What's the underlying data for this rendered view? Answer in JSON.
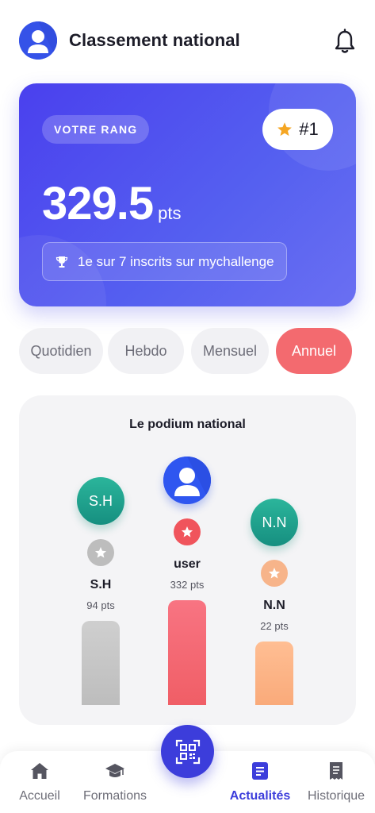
{
  "header": {
    "title": "Classement national",
    "avatar_icon": "user-avatar-icon",
    "notification_icon": "bell-icon"
  },
  "rank_card": {
    "label": "VOTRE RANG",
    "rank": "#1",
    "rank_icon": "star-icon",
    "score": "329.5",
    "score_unit": "pts",
    "info_text": "1e sur 7 inscrits sur mychallenge",
    "info_icon": "trophy-icon",
    "colors": {
      "gradient_start": "#4a40ee",
      "gradient_end": "#6a6ff2",
      "star": "#f5a623"
    }
  },
  "period_tabs": [
    {
      "label": "Quotidien",
      "active": false
    },
    {
      "label": "Hebdo",
      "active": false
    },
    {
      "label": "Mensuel",
      "active": false
    },
    {
      "label": "Annuel",
      "active": true
    }
  ],
  "podium": {
    "title": "Le podium national",
    "entries": [
      {
        "position": 2,
        "avatar_text": "S.H",
        "name": "S.H",
        "points": "94 pts",
        "medal": "silver"
      },
      {
        "position": 1,
        "avatar_text": "",
        "name": "user",
        "points": "332 pts",
        "medal": "gold"
      },
      {
        "position": 3,
        "avatar_text": "N.N",
        "name": "N.N",
        "points": "22 pts",
        "medal": "bronze"
      }
    ],
    "colors": {
      "silver": "#bdbdbd",
      "gold": "#f0545c",
      "bronze": "#f7b48a",
      "avatar_teal": "#1f9f8c"
    }
  },
  "bottom_nav": {
    "items": [
      {
        "label": "Accueil",
        "icon": "home-icon",
        "active": false
      },
      {
        "label": "Formations",
        "icon": "graduation-cap-icon",
        "active": false
      },
      {
        "label": "Actualités",
        "icon": "news-icon",
        "active": true
      },
      {
        "label": "Historique",
        "icon": "receipt-icon",
        "active": false
      }
    ],
    "center_button_icon": "qr-code-icon",
    "accent": "#3c3ddb"
  }
}
